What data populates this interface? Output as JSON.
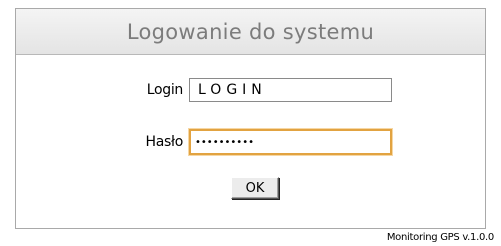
{
  "panel": {
    "title": "Logowanie do systemu"
  },
  "form": {
    "login_label": "Login",
    "login_value": "LOGIN",
    "password_label": "Hasło",
    "password_value": "••••••••••",
    "ok_label": "OK"
  },
  "footer": {
    "version": "Monitoring GPS v.1.0.0"
  },
  "colors": {
    "header_bg": "#e8e8e8",
    "title_text": "#7c7c7c",
    "focus_border": "#e2a341"
  }
}
